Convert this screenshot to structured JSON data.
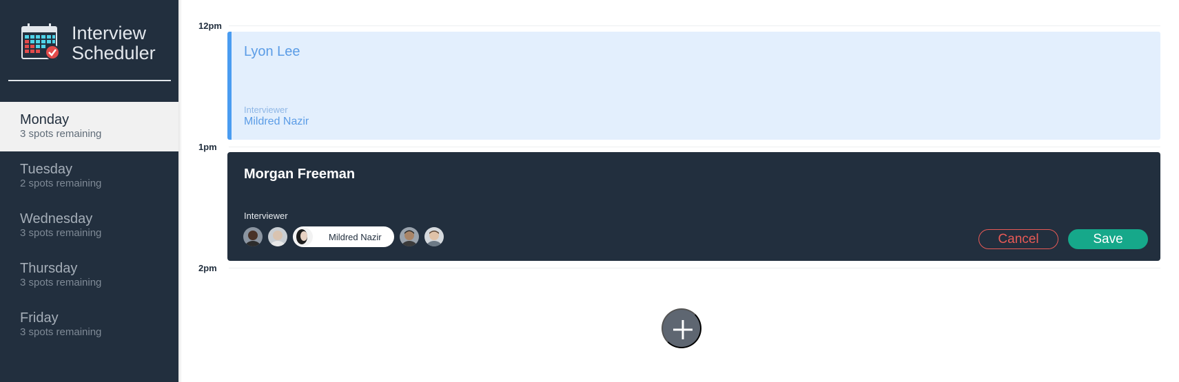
{
  "app": {
    "title_line1": "Interview",
    "title_line2": "Scheduler",
    "logo_icon": "calendar-check-icon"
  },
  "sidebar": {
    "days": [
      {
        "name": "Monday",
        "spots": "3 spots remaining",
        "active": true
      },
      {
        "name": "Tuesday",
        "spots": "2 spots remaining",
        "active": false
      },
      {
        "name": "Wednesday",
        "spots": "3 spots remaining",
        "active": false
      },
      {
        "name": "Thursday",
        "spots": "3 spots remaining",
        "active": false
      },
      {
        "name": "Friday",
        "spots": "3 spots remaining",
        "active": false
      }
    ]
  },
  "schedule": {
    "times": [
      "12pm",
      "1pm",
      "2pm"
    ],
    "booked": {
      "student": "Lyon Lee",
      "interviewer_label": "Interviewer",
      "interviewer": "Mildred Nazir"
    },
    "form": {
      "student": "Morgan Freeman",
      "interviewer_label": "Interviewer",
      "selected_interviewer": "Mildred Nazir",
      "avatar_count": 5,
      "selected_index": 2,
      "cancel_label": "Cancel",
      "save_label": "Save"
    },
    "add_icon": "plus-icon"
  },
  "colors": {
    "sidebar": "#222f3e",
    "booked_bg": "#e3effd",
    "booked_accent": "#4a9cf1",
    "cancel": "#e85a56",
    "save": "#16a88a",
    "add_button": "#5e6671"
  }
}
